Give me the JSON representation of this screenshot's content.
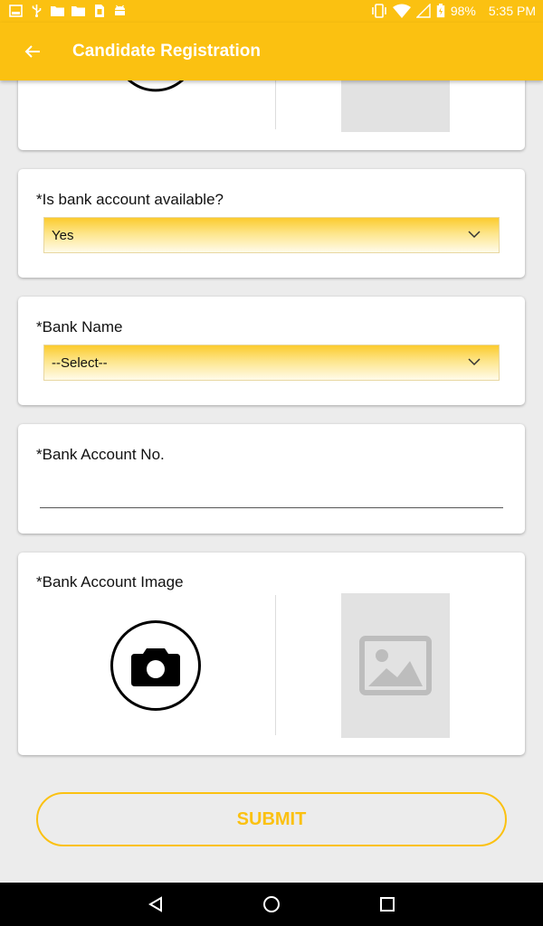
{
  "status_bar": {
    "battery": "98%",
    "time": "5:35 PM",
    "left_icons": [
      "gallery-icon",
      "usb-icon",
      "folder-icon",
      "folder-icon",
      "sim-card-icon",
      "android-icon"
    ],
    "right_icons": [
      "vibrate-icon",
      "wifi-icon",
      "no-signal-icon",
      "battery-icon"
    ]
  },
  "app_bar": {
    "title": "Candidate Registration",
    "back_icon": "arrow-back-icon"
  },
  "form": {
    "bank_account_available": {
      "label": "*Is bank account available?",
      "value": "Yes"
    },
    "bank_name": {
      "label": "*Bank Name",
      "value": "--Select--"
    },
    "bank_account_no": {
      "label": "*Bank Account No.",
      "value": ""
    },
    "bank_account_image": {
      "label": "*Bank Account Image",
      "camera_icon": "camera-icon",
      "placeholder_icon": "image-placeholder-icon"
    }
  },
  "submit_label": "SUBMIT",
  "nav": {
    "back_icon": "nav-back-icon",
    "home_icon": "nav-home-icon",
    "recents_icon": "nav-recents-icon"
  },
  "colors": {
    "primary": "#fbc111",
    "background": "#ececec",
    "card": "#ffffff",
    "placeholder": "#e2e2e2"
  }
}
